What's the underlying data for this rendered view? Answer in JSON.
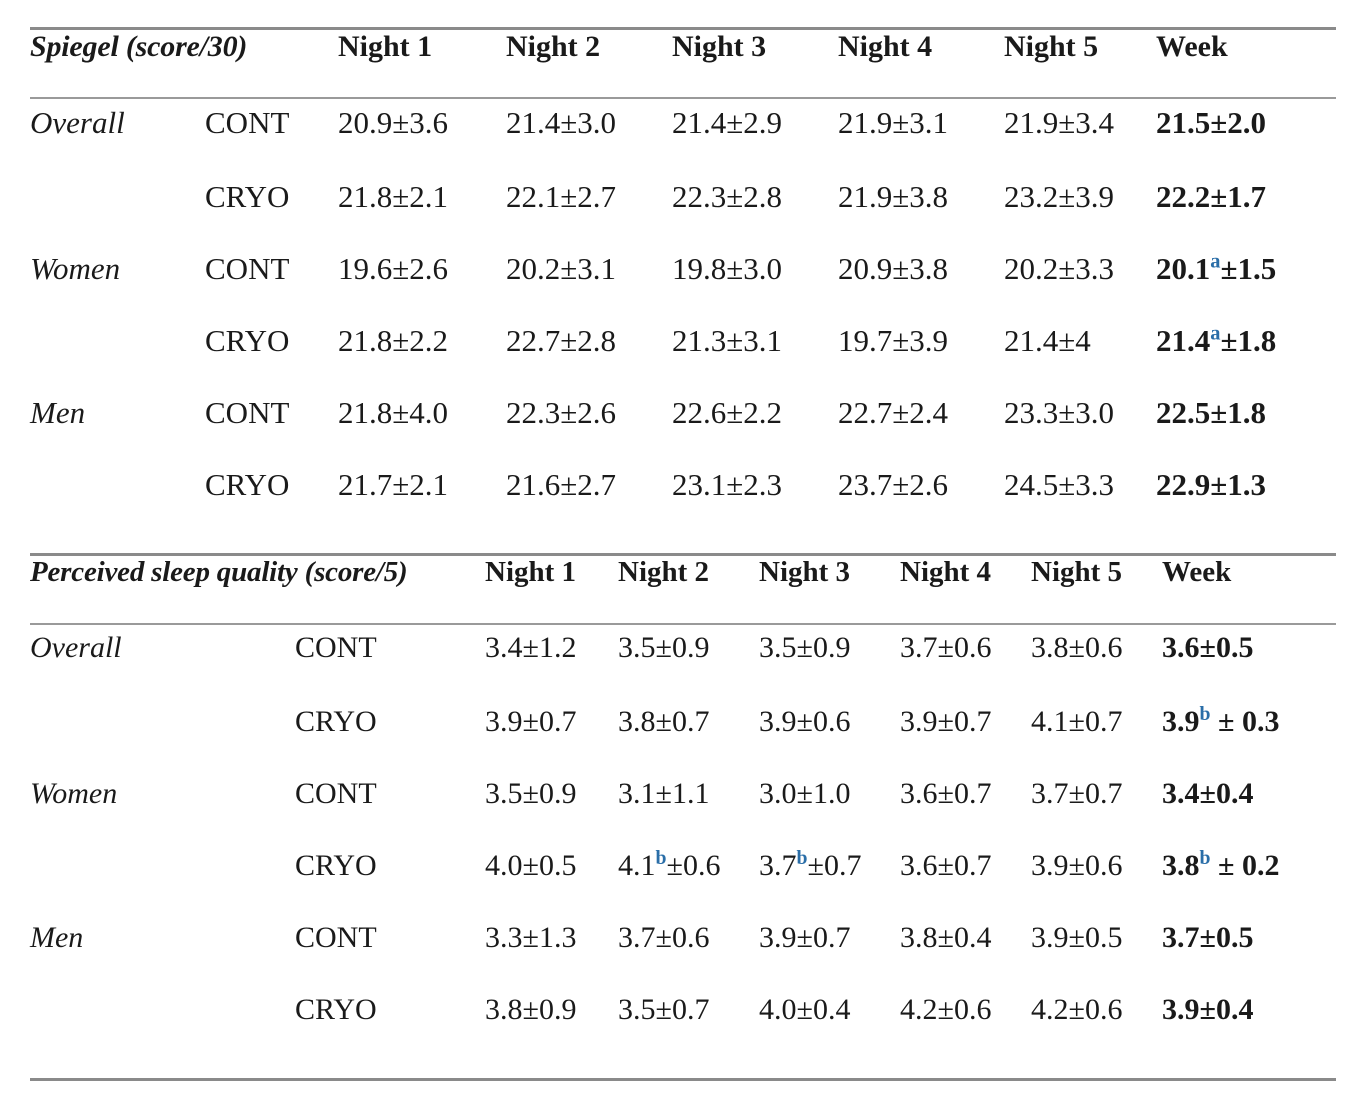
{
  "colors": {
    "rule": "#8a8a8a",
    "text": "#1a1a1a",
    "footnote_marker": "#2a6ea8"
  },
  "tables": [
    {
      "id": "spiegel",
      "title": "Spiegel (score/30)",
      "columns": [
        "Night 1",
        "Night 2",
        "Night 3",
        "Night 4",
        "Night 5",
        "Week"
      ],
      "rows": [
        {
          "label": "Overall",
          "group": "CONT",
          "values": [
            "20.9±3.6",
            "21.4±3.0",
            "21.4±2.9",
            "21.9±3.1",
            "21.9±3.4"
          ],
          "week": "21.5±2.0",
          "week_mark": ""
        },
        {
          "label": "",
          "group": "CRYO",
          "values": [
            "21.8±2.1",
            "22.1±2.7",
            "22.3±2.8",
            "21.9±3.8",
            "23.2±3.9"
          ],
          "week": "22.2±1.7",
          "week_mark": ""
        },
        {
          "label": "Women",
          "group": "CONT",
          "values": [
            "19.6±2.6",
            "20.2±3.1",
            "19.8±3.0",
            "20.9±3.8",
            "20.2±3.3"
          ],
          "week_prefix": "20.1",
          "week_mark": "a",
          "week_suffix": "±1.5"
        },
        {
          "label": "",
          "group": "CRYO",
          "values": [
            "21.8±2.2",
            "22.7±2.8",
            "21.3±3.1",
            "19.7±3.9",
            "21.4±4"
          ],
          "week_prefix": "21.4",
          "week_mark": "a",
          "week_suffix": "±1.8"
        },
        {
          "label": "Men",
          "group": "CONT",
          "values": [
            "21.8±4.0",
            "22.3±2.6",
            "22.6±2.2",
            "22.7±2.4",
            "23.3±3.0"
          ],
          "week": "22.5±1.8",
          "week_mark": ""
        },
        {
          "label": "",
          "group": "CRYO",
          "values": [
            "21.7±2.1",
            "21.6±2.7",
            "23.1±2.3",
            "23.7±2.6",
            "24.5±3.3"
          ],
          "week": "22.9±1.3",
          "week_mark": ""
        }
      ]
    },
    {
      "id": "perceived-sleep-quality",
      "title": "Perceived sleep quality (score/5)",
      "columns": [
        "Night 1",
        "Night 2",
        "Night 3",
        "Night 4",
        "Night 5",
        "Week"
      ],
      "rows": [
        {
          "label": "Overall",
          "group": "CONT",
          "values": [
            "3.4±1.2",
            "3.5±0.9",
            "3.5±0.9",
            "3.7±0.6",
            "3.8±0.6"
          ],
          "week": "3.6±0.5",
          "week_mark": ""
        },
        {
          "label": "",
          "group": "CRYO",
          "values": [
            "3.9±0.7",
            "3.8±0.7",
            "3.9±0.6",
            "3.9±0.7",
            "4.1±0.7"
          ],
          "week_prefix": "3.9",
          "week_mark": "b",
          "week_suffix": " ± 0.3"
        },
        {
          "label": "Women",
          "group": "CONT",
          "values": [
            "3.5±0.9",
            "3.1±1.1",
            "3.0±1.0",
            "3.6±0.7",
            "3.7±0.7"
          ],
          "week": "3.4±0.4",
          "week_mark": ""
        },
        {
          "label": "",
          "group": "CRYO",
          "values": [
            "4.0±0.5",
            "",
            "",
            "3.6±0.7",
            "3.9±0.6"
          ],
          "value_marks": [
            {
              "index": 1,
              "prefix": "4.1",
              "mark": "b",
              "suffix": "±0.6"
            },
            {
              "index": 2,
              "prefix": "3.7",
              "mark": "b",
              "suffix": "±0.7"
            }
          ],
          "week_prefix": "3.8",
          "week_mark": "b",
          "week_suffix": " ± 0.2"
        },
        {
          "label": "Men",
          "group": "CONT",
          "values": [
            "3.3±1.3",
            "3.7±0.6",
            "3.9±0.7",
            "3.8±0.4",
            "3.9±0.5"
          ],
          "week": "3.7±0.5",
          "week_mark": ""
        },
        {
          "label": "",
          "group": "CRYO",
          "values": [
            "3.8±0.9",
            "3.5±0.7",
            "4.0±0.4",
            "4.2±0.6",
            "4.2±0.6"
          ],
          "week": "3.9±0.4",
          "week_mark": ""
        }
      ]
    }
  ]
}
